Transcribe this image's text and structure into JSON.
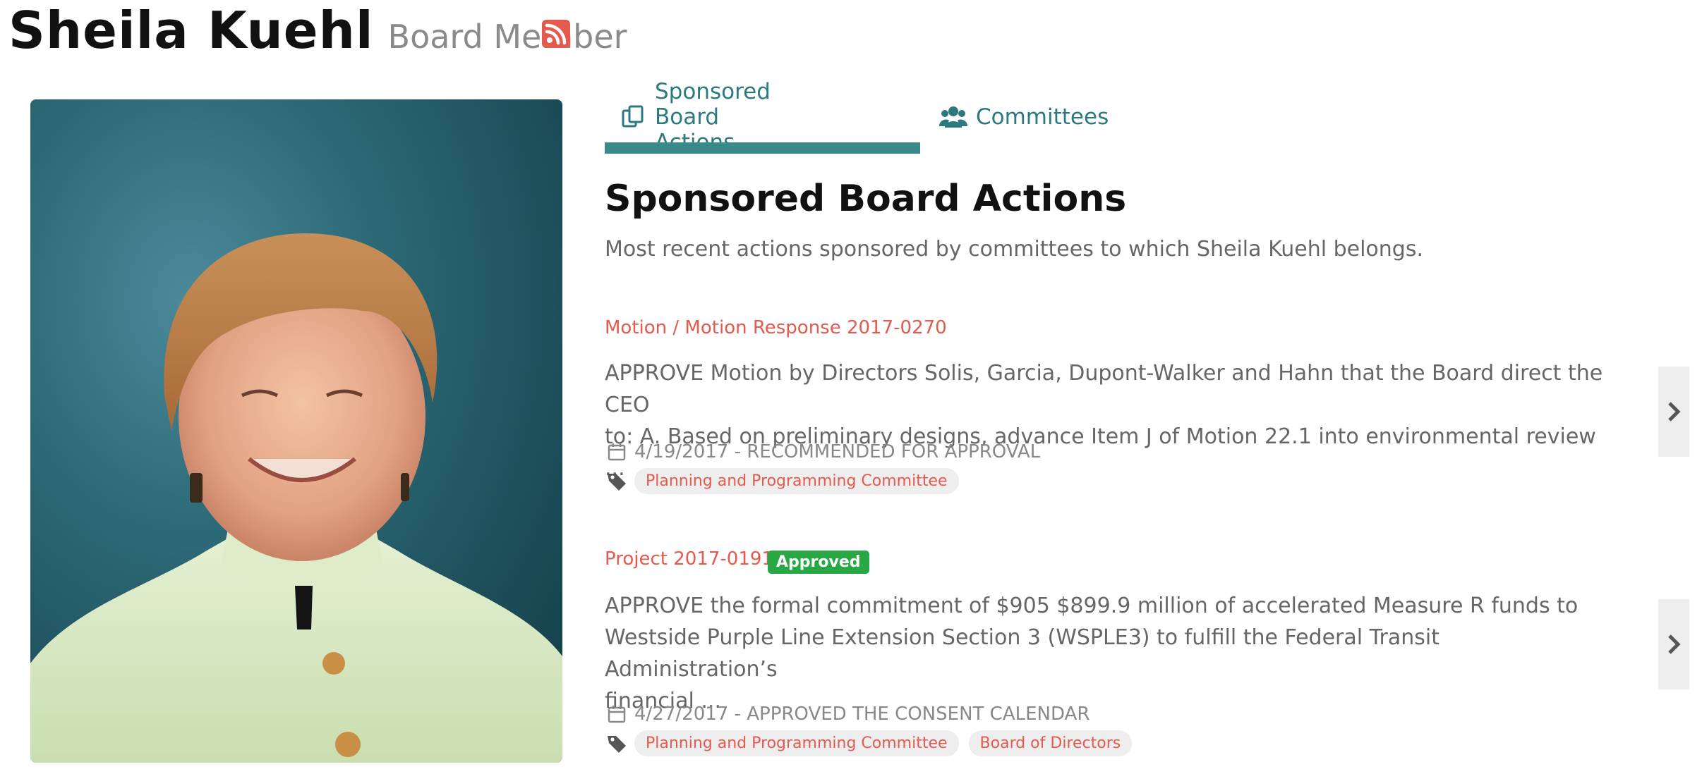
{
  "header": {
    "name": "Sheila Kuehl",
    "role": "Board Member"
  },
  "icons": {
    "rss": "rss-icon",
    "tab_actions": "documents-icon",
    "tab_committees": "users-icon",
    "calendar": "calendar-icon",
    "tag": "tag-icon",
    "next": "chevron-right-icon"
  },
  "colors": {
    "accent": "#2c7a7f",
    "link": "#e55a4e",
    "approved": "#28a745"
  },
  "tabs": [
    {
      "label": "Sponsored Board Actions",
      "active": true
    },
    {
      "label": "Committees",
      "active": false
    }
  ],
  "section": {
    "title": "Sponsored Board Actions",
    "subtitle": "Most recent actions sponsored by committees to which Sheila Kuehl belongs."
  },
  "actions": [
    {
      "link": "Motion / Motion Response 2017-0270",
      "badge": "",
      "desc_line1": "APPROVE Motion by Directors Solis, Garcia, Dupont-Walker and Hahn that the Board direct the CEO",
      "desc_line2": "to: A. Based on preliminary designs, advance Item J of Motion 22.1 into environmental review ...",
      "desc_line3": "",
      "date_status": "4/19/2017 - RECOMMENDED FOR APPROVAL",
      "tags": [
        "Planning and Programming Committee"
      ]
    },
    {
      "link": "Project 2017-0191",
      "badge": "Approved",
      "desc_line1": "APPROVE the formal commitment of $905 $899.9 million of accelerated Measure R funds to",
      "desc_line2": "Westside Purple Line Extension Section 3 (WSPLE3) to fulfill the Federal Transit Administration’s",
      "desc_line3": "financial ...",
      "date_status": "4/27/2017 - APPROVED THE CONSENT CALENDAR",
      "tags": [
        "Planning and Programming Committee",
        "Board of Directors"
      ]
    }
  ]
}
